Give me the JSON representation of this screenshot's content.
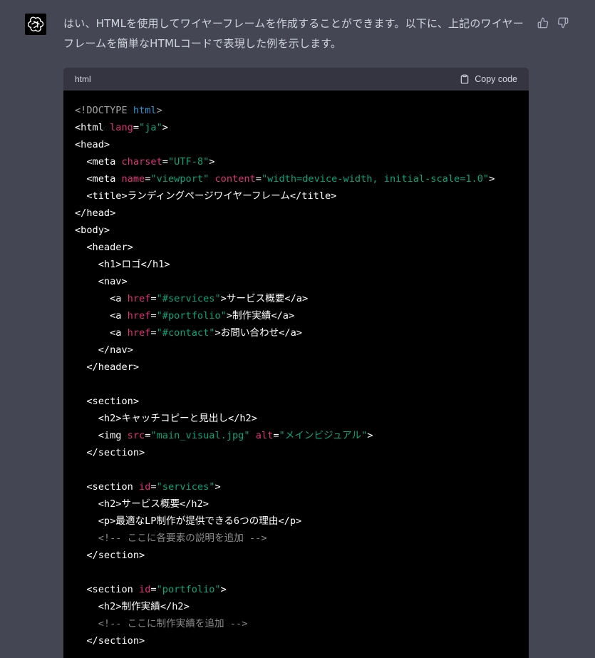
{
  "message": {
    "text": "はい、HTMLを使用してワイヤーフレームを作成することができます。以下に、上記のワイヤーフレームを簡単なHTMLコードで表現した例を示します。"
  },
  "feedback": {
    "thumbs_up_icon": "thumbs-up-icon",
    "thumbs_down_icon": "thumbs-down-icon"
  },
  "code_block": {
    "language": "html",
    "copy_label": "Copy code",
    "lines": [
      [
        {
          "t": "doc",
          "v": "<!DOCTYPE "
        },
        {
          "t": "doctype-key",
          "v": "html"
        },
        {
          "t": "doc",
          "v": ">"
        }
      ],
      [
        {
          "t": "plain",
          "v": "<html "
        },
        {
          "t": "attr",
          "v": "lang"
        },
        {
          "t": "plain",
          "v": "="
        },
        {
          "t": "str",
          "v": "\"ja\""
        },
        {
          "t": "plain",
          "v": ">"
        }
      ],
      [
        {
          "t": "plain",
          "v": "<head>"
        }
      ],
      [
        {
          "t": "plain",
          "v": "  <meta "
        },
        {
          "t": "attr",
          "v": "charset"
        },
        {
          "t": "plain",
          "v": "="
        },
        {
          "t": "str",
          "v": "\"UTF-8\""
        },
        {
          "t": "plain",
          "v": ">"
        }
      ],
      [
        {
          "t": "plain",
          "v": "  <meta "
        },
        {
          "t": "attr",
          "v": "name"
        },
        {
          "t": "plain",
          "v": "="
        },
        {
          "t": "str",
          "v": "\"viewport\""
        },
        {
          "t": "plain",
          "v": " "
        },
        {
          "t": "attr",
          "v": "content"
        },
        {
          "t": "plain",
          "v": "="
        },
        {
          "t": "str",
          "v": "\"width=device-width, initial-scale=1.0\""
        },
        {
          "t": "plain",
          "v": ">"
        }
      ],
      [
        {
          "t": "plain",
          "v": "  <title>ランディングページワイヤーフレーム</title>"
        }
      ],
      [
        {
          "t": "plain",
          "v": "</head>"
        }
      ],
      [
        {
          "t": "plain",
          "v": "<body>"
        }
      ],
      [
        {
          "t": "plain",
          "v": "  <header>"
        }
      ],
      [
        {
          "t": "plain",
          "v": "    <h1>ロゴ</h1>"
        }
      ],
      [
        {
          "t": "plain",
          "v": "    <nav>"
        }
      ],
      [
        {
          "t": "plain",
          "v": "      <a "
        },
        {
          "t": "attr",
          "v": "href"
        },
        {
          "t": "plain",
          "v": "="
        },
        {
          "t": "str",
          "v": "\"#services\""
        },
        {
          "t": "plain",
          "v": ">サービス概要</a>"
        }
      ],
      [
        {
          "t": "plain",
          "v": "      <a "
        },
        {
          "t": "attr",
          "v": "href"
        },
        {
          "t": "plain",
          "v": "="
        },
        {
          "t": "str",
          "v": "\"#portfolio\""
        },
        {
          "t": "plain",
          "v": ">制作実績</a>"
        }
      ],
      [
        {
          "t": "plain",
          "v": "      <a "
        },
        {
          "t": "attr",
          "v": "href"
        },
        {
          "t": "plain",
          "v": "="
        },
        {
          "t": "str",
          "v": "\"#contact\""
        },
        {
          "t": "plain",
          "v": ">お問い合わせ</a>"
        }
      ],
      [
        {
          "t": "plain",
          "v": "    </nav>"
        }
      ],
      [
        {
          "t": "plain",
          "v": "  </header>"
        }
      ],
      [
        {
          "t": "plain",
          "v": ""
        }
      ],
      [
        {
          "t": "plain",
          "v": "  <section>"
        }
      ],
      [
        {
          "t": "plain",
          "v": "    <h2>キャッチコピーと見出し</h2>"
        }
      ],
      [
        {
          "t": "plain",
          "v": "    <img "
        },
        {
          "t": "attr",
          "v": "src"
        },
        {
          "t": "plain",
          "v": "="
        },
        {
          "t": "str",
          "v": "\"main_visual.jpg\""
        },
        {
          "t": "plain",
          "v": " "
        },
        {
          "t": "attr",
          "v": "alt"
        },
        {
          "t": "plain",
          "v": "="
        },
        {
          "t": "str",
          "v": "\"メインビジュアル\""
        },
        {
          "t": "plain",
          "v": ">"
        }
      ],
      [
        {
          "t": "plain",
          "v": "  </section>"
        }
      ],
      [
        {
          "t": "plain",
          "v": ""
        }
      ],
      [
        {
          "t": "plain",
          "v": "  <section "
        },
        {
          "t": "attr",
          "v": "id"
        },
        {
          "t": "plain",
          "v": "="
        },
        {
          "t": "str",
          "v": "\"services\""
        },
        {
          "t": "plain",
          "v": ">"
        }
      ],
      [
        {
          "t": "plain",
          "v": "    <h2>サービス概要</h2>"
        }
      ],
      [
        {
          "t": "plain",
          "v": "    <p>最適なLP制作が提供できる6つの理由</p>"
        }
      ],
      [
        {
          "t": "comment",
          "v": "    <!-- ここに各要素の説明を追加 -->"
        }
      ],
      [
        {
          "t": "plain",
          "v": "  </section>"
        }
      ],
      [
        {
          "t": "plain",
          "v": ""
        }
      ],
      [
        {
          "t": "plain",
          "v": "  <section "
        },
        {
          "t": "attr",
          "v": "id"
        },
        {
          "t": "plain",
          "v": "="
        },
        {
          "t": "str",
          "v": "\"portfolio\""
        },
        {
          "t": "plain",
          "v": ">"
        }
      ],
      [
        {
          "t": "plain",
          "v": "    <h2>制作実績</h2>"
        }
      ],
      [
        {
          "t": "comment",
          "v": "    <!-- ここに制作実績を追加 -->"
        }
      ],
      [
        {
          "t": "plain",
          "v": "  </section>"
        }
      ]
    ]
  }
}
